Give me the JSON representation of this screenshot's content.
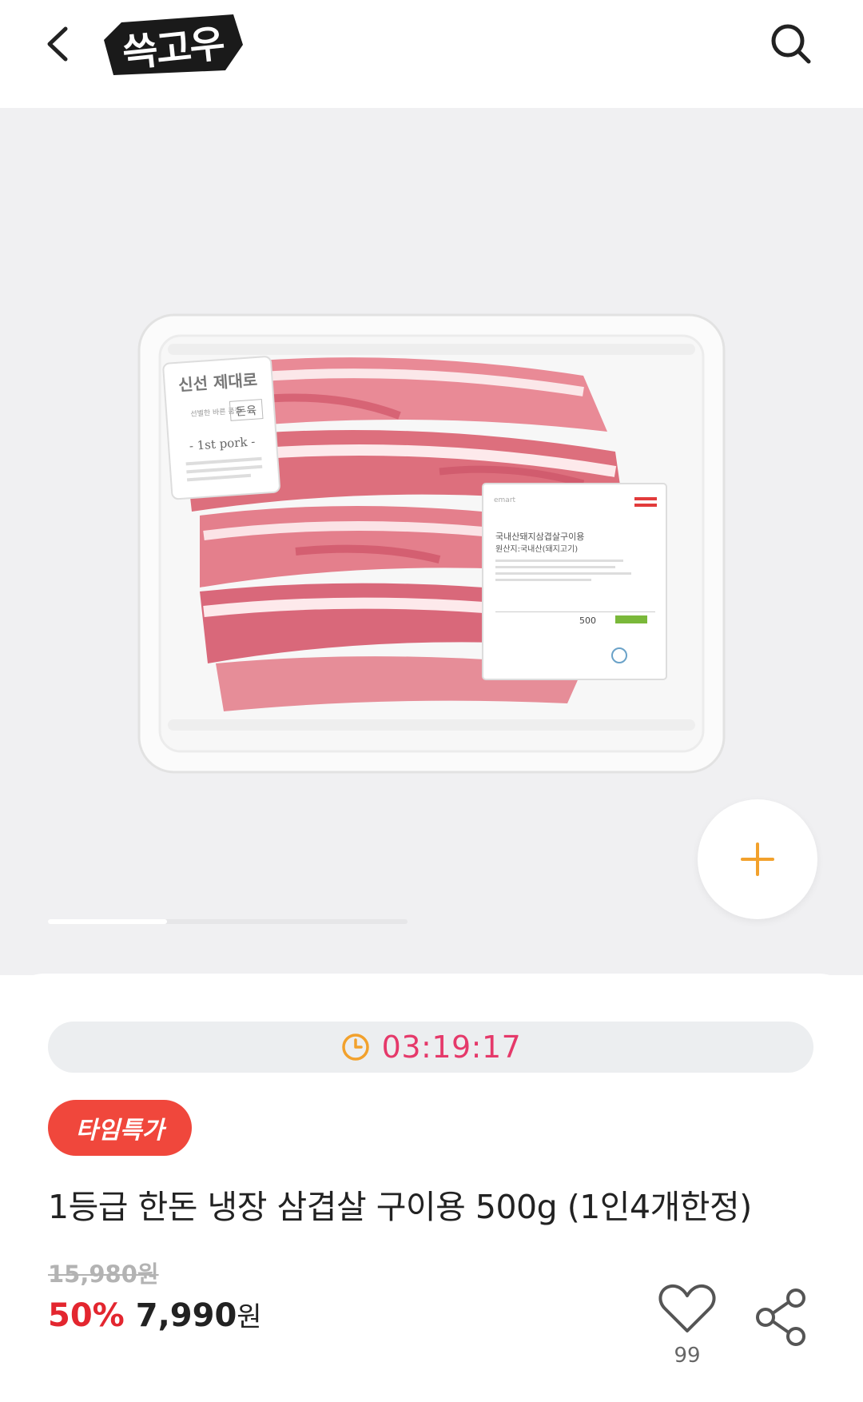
{
  "header": {
    "logo_text": "쓱고우",
    "back_icon": "chevron-left-icon",
    "search_icon": "search-icon"
  },
  "gallery": {
    "progress": 0.33,
    "zoom_icon": "plus-icon",
    "label_brand": "신선 제대로",
    "label_quality": "선별한 바른 품질",
    "label_meat": "돈육",
    "label_grade": "- 1st pork -",
    "sticker_brand": "emart",
    "sticker_name": "국내산돼지삼겹살구이용",
    "sticker_origin": "원산지:국내산(돼지고기)",
    "sticker_weight": "500"
  },
  "deal": {
    "timer": "03:19:17",
    "timer_icon": "clock-icon",
    "badge": "타임특가",
    "title": "1등급 한돈 냉장 삼겹살 구이용 500g (1인4개한정)",
    "original_price": "15,980원",
    "discount": "50%",
    "sale_price": "7,990",
    "currency": "원",
    "likes": "99",
    "like_icon": "heart-icon",
    "share_icon": "share-icon"
  },
  "colors": {
    "accent_pink": "#e5396a",
    "discount_red": "#e3262f",
    "badge_red": "#f0473c",
    "timer_orange": "#f2a12c",
    "plus_orange": "#f2a12c"
  }
}
